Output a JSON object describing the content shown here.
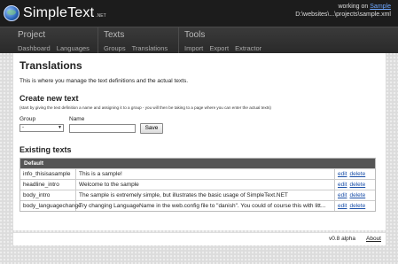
{
  "brand": {
    "name": "SimpleText",
    "suffix": ".NET"
  },
  "working": {
    "prefix": "working on",
    "link": "Sample",
    "path": "D:\\websites\\...\\projects\\sample.xml"
  },
  "nav": [
    {
      "title": "Project",
      "links": [
        "Dashboard",
        "Languages"
      ]
    },
    {
      "title": "Texts",
      "links": [
        "Groups",
        "Translations"
      ]
    },
    {
      "title": "Tools",
      "links": [
        "Import",
        "Export",
        "Extractor"
      ]
    }
  ],
  "page": {
    "title": "Translations",
    "intro": "This is where you manage the text definitions and the actual texts."
  },
  "create": {
    "heading": "Create new text",
    "hint": "(start by giving the text definition a name and assigning it to a group - you will then be taking to a page where you can enter the actual texts)",
    "group_label": "Group",
    "group_value": "-",
    "name_label": "Name",
    "name_value": "",
    "save_label": "Save"
  },
  "existing": {
    "heading": "Existing texts",
    "group_header": "Default",
    "rows": [
      {
        "key": "info_thisisasample",
        "value": "This is a sample!",
        "edit": "edit",
        "delete": "delete"
      },
      {
        "key": "headline_intro",
        "value": "Welcome to the sample",
        "edit": "edit",
        "delete": "delete"
      },
      {
        "key": "body_intro",
        "value": "The sample is extremely simple, but illustrates the basic usage of SimpleText.NET",
        "edit": "edit",
        "delete": "delete"
      },
      {
        "key": "body_languagechange",
        "value": "Try changing LanguageName in the web.config file to \"danish\". You could of course this with litt...",
        "edit": "edit",
        "delete": "delete"
      }
    ]
  },
  "footer": {
    "version": "v0.8 alpha",
    "about": "About"
  },
  "colors": {
    "header_bg": "#1c1c1c",
    "nav_bg": "#333333",
    "link": "#1a4fa8",
    "table_header": "#555555"
  }
}
